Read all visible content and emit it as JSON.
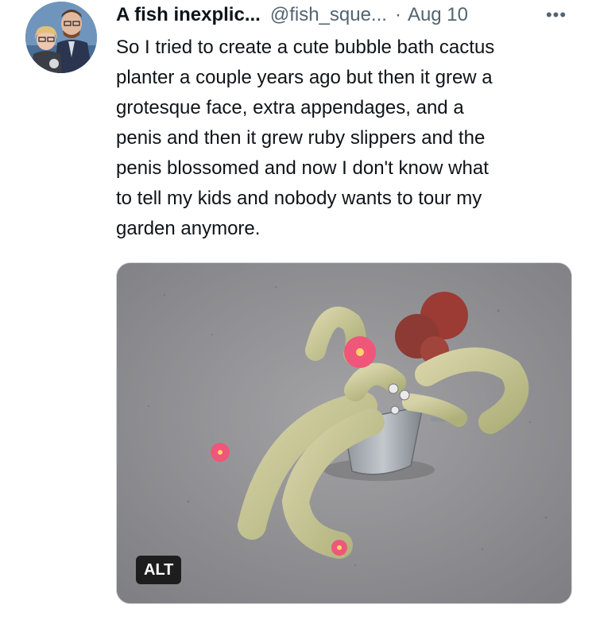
{
  "tweet": {
    "author_name": "A fish inexplic...",
    "handle": "@fish_sque...",
    "separator": "·",
    "date": "Aug 10",
    "more_icon": "more-horizontal-icon",
    "text": "So I tried to create a cute bubble bath cactus\nplanter a couple years ago but then it grew a\ngrotesque face, extra appendages, and a\npenis and then it grew ruby slippers and the\npenis blossomed and now I don't know what\nto tell my kids and nobody wants to tour my\ngarden anymore.",
    "media": {
      "alt_label": "ALT"
    }
  },
  "colors": {
    "text": "#0f1419",
    "secondary": "#536471",
    "media_border": "#cfd9de"
  }
}
